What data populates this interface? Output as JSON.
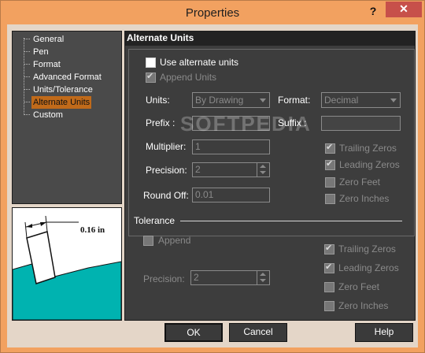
{
  "window": {
    "title": "Properties",
    "help_glyph": "?",
    "close_glyph": "✕"
  },
  "tree": {
    "items": [
      {
        "label": "General"
      },
      {
        "label": "Pen"
      },
      {
        "label": "Format"
      },
      {
        "label": "Advanced Format"
      },
      {
        "label": "Units/Tolerance"
      },
      {
        "label": "Alternate Units",
        "selected": true
      },
      {
        "label": "Custom"
      }
    ]
  },
  "preview": {
    "dimension_label": "0.16 in"
  },
  "panel": {
    "title": "Alternate Units",
    "use_alternate_units": {
      "label": "Use alternate units",
      "checked": false
    },
    "append_units": {
      "label": "Append Units",
      "checked": true,
      "disabled": true
    },
    "units": {
      "label": "Units:",
      "value": "By Drawing"
    },
    "format": {
      "label": "Format:",
      "value": "Decimal"
    },
    "prefix": {
      "label": "Prefix :",
      "value": ""
    },
    "suffix": {
      "label": "Suffix :",
      "value": ""
    },
    "multiplier": {
      "label": "Multiplier:",
      "value": "1"
    },
    "precision": {
      "label": "Precision:",
      "value": "2"
    },
    "round_off": {
      "label": "Round Off:",
      "value": "0.01"
    },
    "zeros": {
      "trailing": {
        "label": "Trailing Zeros",
        "checked": true
      },
      "leading": {
        "label": "Leading Zeros",
        "checked": true
      },
      "feet": {
        "label": "Zero Feet",
        "checked": false
      },
      "inches": {
        "label": "Zero Inches",
        "checked": false
      }
    },
    "tolerance": {
      "label": "Tolerance",
      "append": {
        "label": "Append",
        "checked": false
      },
      "precision": {
        "label": "Precision:",
        "value": "2"
      },
      "trailing": {
        "label": "Trailing Zeros",
        "checked": true
      },
      "leading": {
        "label": "Leading Zeros",
        "checked": true
      },
      "feet": {
        "label": "Zero Feet",
        "checked": false
      },
      "inches": {
        "label": "Zero Inches",
        "checked": false
      }
    }
  },
  "watermark": "SOFTPEDIA",
  "buttons": {
    "ok": "OK",
    "cancel": "Cancel",
    "help": "Help"
  }
}
